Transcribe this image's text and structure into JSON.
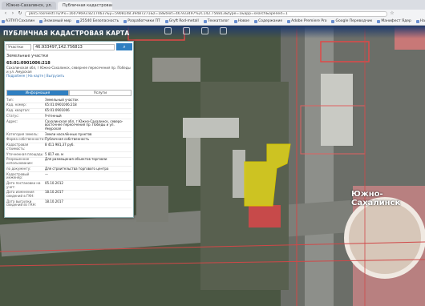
{
  "browser": {
    "tabs": [
      {
        "label": "Южно-Сахалинск, ул.",
        "active": false
      },
      {
        "label": "Публичная кадастровая",
        "active": true
      }
    ],
    "url": "pkk5.rosreestr.ru/#x=16079693.82174637&y=5908148.39487271&z=18&text=46.933497%2C142.756813&type=1&app=search&opened=1",
    "bookmarks": [
      "АЗТУЛ Сахалин",
      "Знакомый мир",
      "25540 Безопасность",
      "Разработчики ПТ",
      "Gryft Rod-metall",
      "Техкаталог",
      "Новое",
      "Содержание",
      "Adobe Premiere Pro",
      "Google Переводчик",
      "Манифест Ядер",
      "Настройки"
    ]
  },
  "app": {
    "title": "ПУБЛИЧНАЯ КАДАСТРОВАЯ КАРТА"
  },
  "search": {
    "type": "Участки",
    "value": "46.933497,142.756813",
    "button": "⌕"
  },
  "section_title": "Земельные участки",
  "object": {
    "number": "65:01:0901006:218",
    "address": "Сахалинская обл, г Южно-Сахалинск, севернее пересечения пр. Победы и ул. Амурская",
    "links": "Подробнее | На карте | Выгрузить"
  },
  "tabs": [
    "Информация",
    "Услуги"
  ],
  "rows": [
    {
      "k": "Тип:",
      "v": "Земельный участок"
    },
    {
      "k": "Кад. номер:",
      "v": "65:01:0901006:218"
    },
    {
      "k": "Кад. квартал:",
      "v": "65:01:0901006"
    },
    {
      "k": "Статус:",
      "v": "Учтенный"
    },
    {
      "k": "Адрес:",
      "v": "Сахалинская обл, г Южно-Сахалинск, северо-восточнее пересечения пр. Победы и ул. Амурская"
    },
    {
      "k": "Категория земель:",
      "v": "Земли населённых пунктов"
    },
    {
      "k": "Форма собственности:",
      "v": "Публичная собственность"
    },
    {
      "k": "Кадастровая стоимость:",
      "v": "8 411 981,37 руб."
    },
    {
      "k": "Уточненная площадь:",
      "v": "5 817 кв. м"
    },
    {
      "k": "Разрешенное использование:",
      "v": "Для размещения объектов торговли"
    },
    {
      "k": "по документу:",
      "v": "Для строительства торгового центра"
    },
    {
      "k": "Кадастровый инженер:",
      "v": "—"
    },
    {
      "k": "Дата постановки на учет:",
      "v": "05.10.2012"
    },
    {
      "k": "Дата изменения сведений в ГКН:",
      "v": "18.10.2017"
    },
    {
      "k": "Дата выгрузки сведений из ГКН:",
      "v": "18.10.2017"
    }
  ],
  "map_labels": {
    "city": "Южно-Сахалинск"
  }
}
